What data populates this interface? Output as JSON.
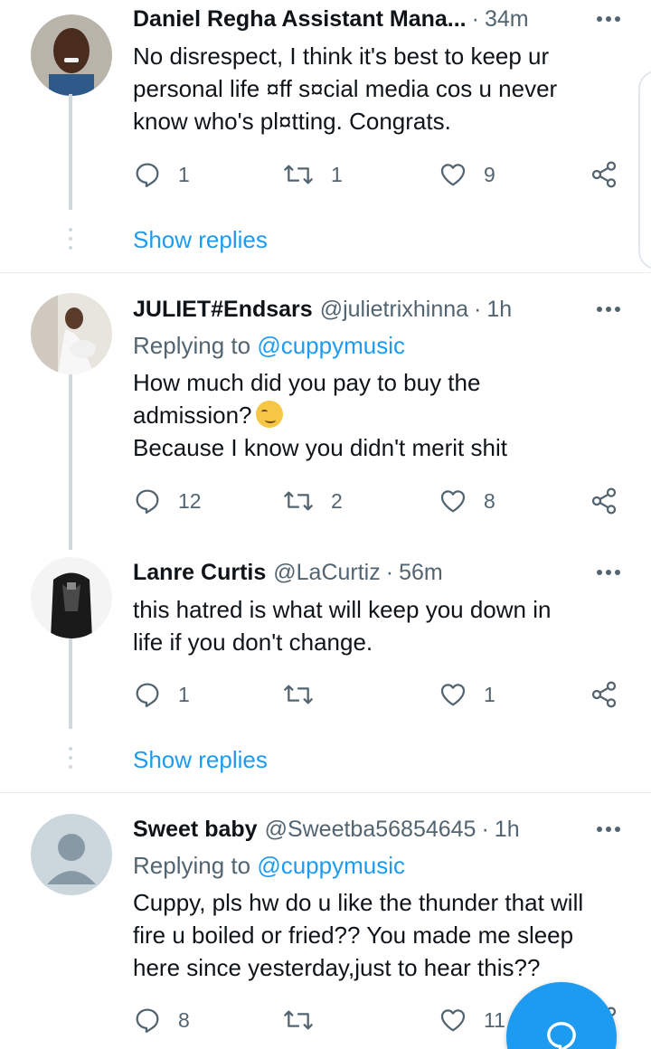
{
  "tweets": [
    {
      "name": "Daniel Regha Assistant Mana...",
      "handle": "",
      "time": "34m",
      "lines": [
        "No disrespect, I think it's best to keep ur",
        "personal life ¤ff s¤cial media cos u never",
        "know who's pl¤tting. Congrats."
      ],
      "replies": "1",
      "retweets": "1",
      "likes": "9",
      "show_replies": "Show replies"
    },
    {
      "name": "JULIET#Endsars",
      "handle": "@julietrixhinna",
      "time": "1h",
      "replying_prefix": "Replying to",
      "replying_to": "@cuppymusic",
      "lines": [
        "How much did you pay to buy the",
        "admission?",
        "Because I know you didn't merit shit"
      ],
      "emoji": "smirking-face-emoji",
      "replies": "12",
      "retweets": "2",
      "likes": "8"
    },
    {
      "name": "Lanre Curtis",
      "handle": "@LaCurtiz",
      "time": "56m",
      "lines": [
        "this hatred is what will keep you down in",
        "life if you don't change."
      ],
      "replies": "1",
      "retweets": "",
      "likes": "1",
      "show_replies": "Show replies"
    },
    {
      "name": "Sweet baby",
      "handle": "@Sweetba56854645",
      "time": "1h",
      "replying_prefix": "Replying to",
      "replying_to": "@cuppymusic",
      "lines": [
        "Cuppy, pls hw do u like the thunder that will",
        "fire u boiled or fried??  You made me sleep",
        "here since yesterday,just to hear this??"
      ],
      "replies": "8",
      "retweets": "",
      "likes": "11"
    }
  ],
  "separator": "·",
  "icons": {
    "reply": "reply-icon",
    "retweet": "retweet-icon",
    "like": "heart-icon",
    "share": "share-icon",
    "more": "more-options-icon",
    "compose": "compose-reply-icon"
  },
  "colors": {
    "accent": "#1d9bf0",
    "text": "#0f1419",
    "secondary": "#536471",
    "divider": "#e6ecf0"
  }
}
